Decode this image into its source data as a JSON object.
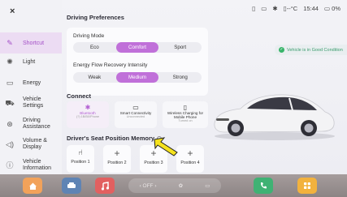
{
  "status": {
    "signal": "▯",
    "screen": "▭",
    "fan": "✱",
    "temp": "▯--°C",
    "time": "15:44",
    "battery": "▭ 0%"
  },
  "nav": {
    "close": "×",
    "items": [
      {
        "label": "Shortcut",
        "icon": "✎"
      },
      {
        "label": "Light",
        "icon": "✺"
      },
      {
        "label": "Energy",
        "icon": "▭"
      },
      {
        "label": "Vehicle\nSettings",
        "icon": "⛟"
      },
      {
        "label": "Driving\nAssistance",
        "icon": "⊛"
      },
      {
        "label": "Volume &\nDisplay",
        "icon": "◁)"
      },
      {
        "label": "Vehicle\nInformation",
        "icon": "ⓘ"
      }
    ]
  },
  "driving_preferences": {
    "title": "Driving Preferences",
    "mode_label": "Driving Mode",
    "modes": [
      "Eco",
      "Comfort",
      "Sport"
    ],
    "selected_mode": "Comfort",
    "recovery_label": "Energy Flow Recovery Intensity",
    "recovery": [
      "Weak",
      "Medium",
      "Strong"
    ],
    "selected_recovery": "Medium"
  },
  "connect": {
    "title": "Connect",
    "items": [
      {
        "icon": "✱",
        "title": "Bluetooth",
        "sub": "(?) 1B/B0/Phone"
      },
      {
        "icon": "▭",
        "title": "Smart Connectivity",
        "sub": "Unconnected"
      },
      {
        "icon": "▯",
        "title": "Wireless Charging for Mobile Phone",
        "sub": "Turned on"
      }
    ]
  },
  "seat_memory": {
    "title": "Driver's Seat Position Memory",
    "positions": [
      "Position 1",
      "Position 2",
      "Position 3",
      "Position 4"
    ]
  },
  "toast": {
    "text": "Vehicle is in Good Condition"
  },
  "dock": {
    "climate_off": "‹ OFF ›",
    "fan": "✿",
    "seat_heat": "▭"
  },
  "colors": {
    "accent": "#c070d9",
    "accent_text": "#a44fc7",
    "ok": "#38b46a"
  }
}
